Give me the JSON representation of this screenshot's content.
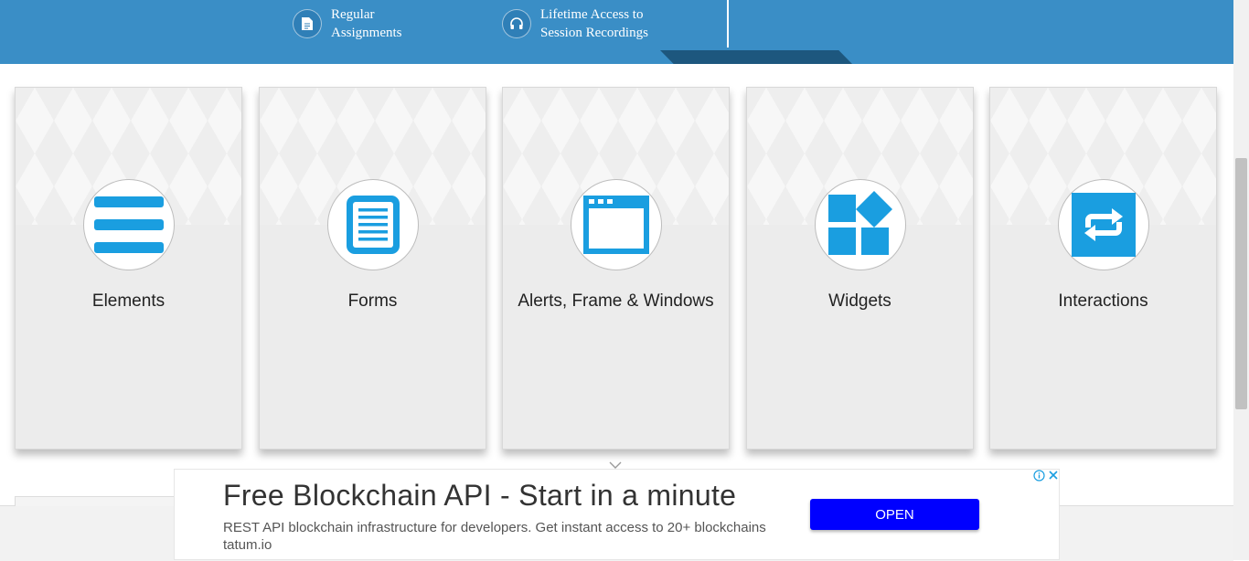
{
  "banner": {
    "features": [
      {
        "icon": "document-icon",
        "line1": "Regular",
        "line2": "Assignments"
      },
      {
        "icon": "headphones-icon",
        "line1": "Lifetime Access to",
        "line2": "Session Recordings"
      }
    ]
  },
  "cards": [
    {
      "label": "Elements",
      "icon": "hamburger-list-icon"
    },
    {
      "label": "Forms",
      "icon": "form-document-icon"
    },
    {
      "label": "Alerts, Frame & Windows",
      "icon": "browser-window-icon"
    },
    {
      "label": "Widgets",
      "icon": "widgets-icon"
    },
    {
      "label": "Interactions",
      "icon": "interactions-arrows-icon"
    }
  ],
  "ad": {
    "headline": "Free Blockchain API - Start in a minute",
    "description": "REST API blockchain infrastructure for developers. Get instant access to 20+ blockchains tatum.io",
    "button": "OPEN"
  },
  "colors": {
    "banner": "#3a8ec6",
    "icon_blue": "#1a9ee0",
    "ad_button": "#0000ff"
  }
}
